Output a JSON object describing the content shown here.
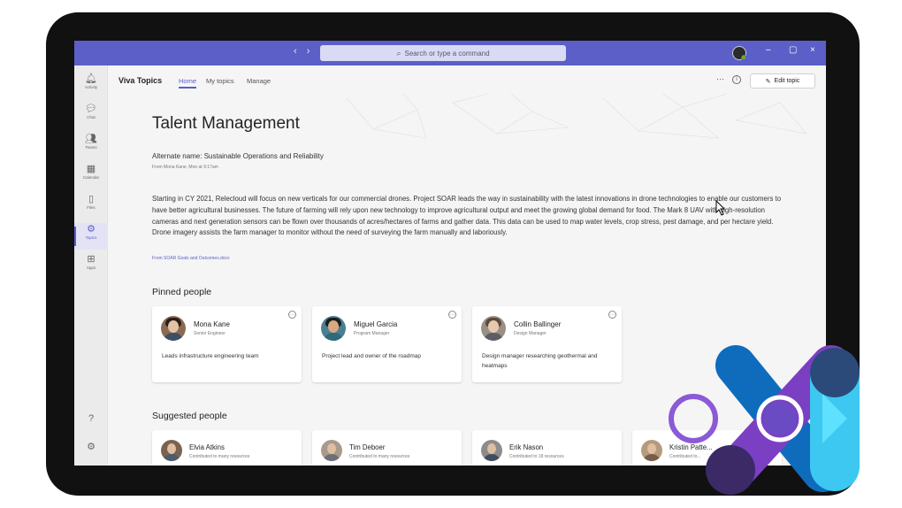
{
  "titlebar": {
    "nav_arrows": "‹ ›",
    "search_placeholder": "Search or type a command",
    "window_controls": [
      "–",
      "▢",
      "×"
    ]
  },
  "rail": {
    "items": [
      {
        "label": "Activity",
        "icon": "bell-icon",
        "glyph": "🔔︎"
      },
      {
        "label": "Chat",
        "icon": "chat-icon",
        "glyph": "💬︎"
      },
      {
        "label": "Teams",
        "icon": "teams-icon",
        "glyph": "👥︎"
      },
      {
        "label": "Calendar",
        "icon": "calendar-icon",
        "glyph": "▦"
      },
      {
        "label": "Files",
        "icon": "file-icon",
        "glyph": "▯"
      },
      {
        "label": "Topics",
        "icon": "topics-icon",
        "glyph": "⚙"
      },
      {
        "label": "Apps",
        "icon": "apps-icon",
        "glyph": "⊞"
      }
    ],
    "active_index": 5,
    "help_glyph": "?",
    "settings_glyph": "⚙"
  },
  "app": {
    "title": "Viva Topics",
    "tabs": [
      "Home",
      "My topics",
      "Manage"
    ],
    "active_tab": 0,
    "more": "···",
    "info": "i",
    "edit_label": "Edit topic",
    "edit_glyph": "✎"
  },
  "topic": {
    "title": "Talent Management",
    "alternate_name": "Alternate name: Sustainable Operations and Reliability",
    "alternate_source": "From Mona Kane, Mon at 9:17am",
    "description": "Starting in CY 2021, Relecloud will focus on new verticals for our commercial drones. Project SOAR leads the way in sustainability with the latest innovations in drone technologies to enable our customers to have better agricultural businesses. The future of farming will rely upon new technology to improve agricultural output and meet the growing global demand for food. The Mark 8 UAV with high-resolution cameras and next generation sensors can be flown over thousands of acres/hectares of farms and gather data. This data can be used to map water levels, crop stress, pest damage, and per hectare yield. Drone imagery assists the farm manager to monitor without the need of surveying the farm manually and laboriously.",
    "description_source": "From SOAR Goals and Outcomes.docx"
  },
  "pinned": {
    "title": "Pinned people",
    "people": [
      {
        "name": "Mona Kane",
        "role": "Senior Engineer",
        "desc": "Leads infrastructure engineering team"
      },
      {
        "name": "Miguel Garcia",
        "role": "Program Manager",
        "desc": "Project lead and owner of the roadmap"
      },
      {
        "name": "Collin Ballinger",
        "role": "Design Manager",
        "desc": "Design manager researching geothermal and heatmaps"
      }
    ]
  },
  "suggested": {
    "title": "Suggested people",
    "people": [
      {
        "name": "Elvia Atkins",
        "role": "Contributed to many resources"
      },
      {
        "name": "Tim Deboer",
        "role": "Contributed to many resources"
      },
      {
        "name": "Erik Nason",
        "role": "Contributed to 18 resources"
      },
      {
        "name": "Kristin Patte...",
        "role": "Contributed to..."
      }
    ]
  },
  "colors": {
    "teams_purple": "#5b5fc7",
    "device_frame": "#111111",
    "logo_blue": "#0f6cbd",
    "logo_purple": "#7b3fc4",
    "logo_cyan": "#3cc8f0",
    "logo_navy": "#2b4a7a"
  }
}
